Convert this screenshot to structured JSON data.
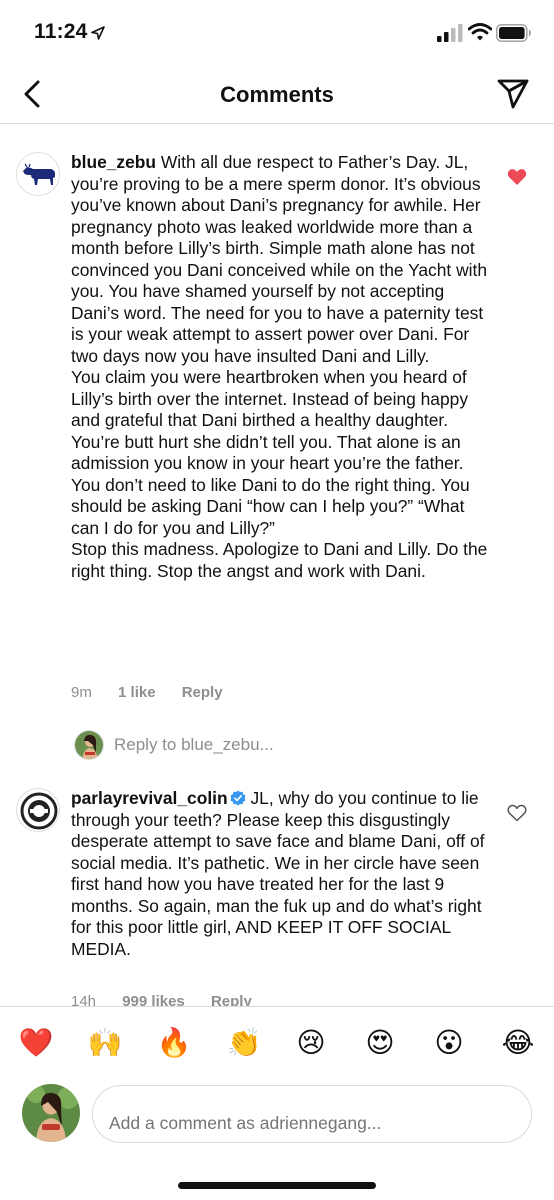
{
  "status": {
    "time": "11:24"
  },
  "header": {
    "title": "Comments"
  },
  "comments": [
    {
      "username": "blue_zebu",
      "paragraphs": [
        "With all due respect to Father’s Day. JL, you’re proving to be a mere sperm donor. It’s obvious you’ve known about Dani’s pregnancy for awhile. Her pregnancy photo was leaked worldwide more than a month before Lilly’s birth. Simple math alone has not convinced you Dani conceived while on the Yacht with you. You have shamed yourself by not accepting Dani’s word. The need for you to have a paternity test is your weak attempt to assert power over Dani. For two days now you have insulted Dani and Lilly.",
        "You claim you were heartbroken when you heard of Lilly’s birth over the internet. Instead of being happy and grateful that Dani birthed a healthy daughter. You’re butt hurt she didn’t tell you. That alone is an admission you know in your heart you’re the father. You don’t need to like Dani to do the right thing. You should be asking Dani “how can I help you?” “What can I do for you and Lilly?”",
        "Stop this madness. Apologize to Dani and Lilly. Do the right thing. Stop the angst and work with Dani."
      ],
      "time": "9m",
      "likes": "1 like",
      "reply_label": "Reply",
      "liked": true,
      "heart_color": "#ed4956"
    },
    {
      "username": "parlayrevival_colin",
      "verified": true,
      "text": "JL, why do you continue to lie through your teeth? Please keep this disgustingly desperate attempt to save face and blame Dani, off of social media. It’s pathetic. We in her circle have seen first hand how you have treated her for the last 9 months. So again, man the fuk up and do what’s right for this poor little girl, AND KEEP IT OFF SOCIAL MEDIA.",
      "time": "14h",
      "likes": "999 likes",
      "reply_label": "Reply",
      "liked": false
    }
  ],
  "reply_prompt": "Reply to blue_zebu...",
  "emojis": [
    {
      "name": "red-heart",
      "char": "❤️"
    },
    {
      "name": "raising-hands",
      "char": "🙌"
    },
    {
      "name": "fire",
      "char": "🔥"
    },
    {
      "name": "clapping-hands",
      "char": "👏"
    },
    {
      "name": "crying-face",
      "char": "😢"
    },
    {
      "name": "heart-eyes",
      "char": "😍"
    },
    {
      "name": "surprised-face",
      "char": "😮"
    },
    {
      "name": "tears-of-joy",
      "char": "😂"
    }
  ],
  "composer": {
    "placeholder": "Add a comment as adriennegang..."
  },
  "colors": {
    "accent_like": "#ed4956",
    "secondary_text": "#8e8e8e",
    "verified_blue": "#3897f0"
  },
  "icons": [
    "location-arrow-icon",
    "signal-icon",
    "wifi-icon",
    "battery-icon",
    "back-chevron-icon",
    "send-icon",
    "heart-icon",
    "verified-badge-icon"
  ]
}
